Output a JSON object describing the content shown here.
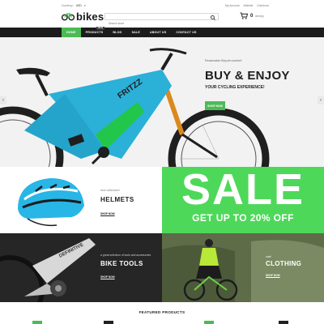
{
  "header": {
    "currency_label": "Currency:",
    "currency_value": "USD",
    "logo_text": "bikes",
    "search_placeholder": "Search store",
    "user_links": [
      "My Account",
      "Wishlist",
      "Checkout"
    ],
    "cart_count": "0",
    "cart_label": "item(s)"
  },
  "nav": {
    "items": [
      "HOME",
      "PRODUCTS",
      "BLOG",
      "SALE",
      "ABOUT US",
      "CONTACT US"
    ],
    "badge": "NEW"
  },
  "hero": {
    "small_text": "Reasonable Bicycle comfort!",
    "title": "BUY & ENJOY",
    "subtitle": "YOUR CYCLING EXPERIENCE!",
    "button": "SHOP NOW",
    "prev": "‹",
    "next": "›",
    "bike_brand": "FRITZZ"
  },
  "banners": {
    "helmets": {
      "small": "new collection!",
      "title": "HELMETS",
      "link": "SHOP NOW"
    },
    "sale": {
      "big": "SALE",
      "sub": "GET UP TO 20% OFF"
    },
    "tools": {
      "small": "a great selection of tools and accessories",
      "title": "BIKE TOOLS",
      "link": "SHOP NOW",
      "bike_brand": "DEFINITIVE"
    },
    "clothing": {
      "small": "sale!",
      "title": "CLOTHING",
      "link": "SHOP NOW"
    }
  },
  "featured": {
    "title": "FEATURED PRODUCTS"
  },
  "colors": {
    "accent": "#4cbb55",
    "sale_bg": "#4ed85a",
    "nav_bg": "#1c1c1c",
    "hero_bike": "#2bb0d8"
  }
}
